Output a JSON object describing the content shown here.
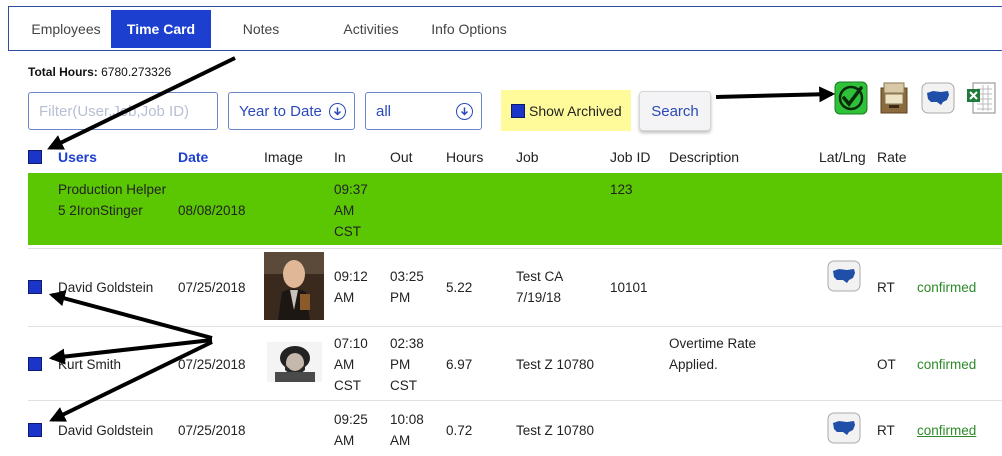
{
  "tabs": [
    {
      "label": "Employees"
    },
    {
      "label": "Time Card"
    },
    {
      "label": "Notes"
    },
    {
      "label": "Activities"
    },
    {
      "label": "Info Options"
    }
  ],
  "total_hours": {
    "label": "Total Hours:",
    "value": "6780.273326"
  },
  "filter": {
    "placeholder": "Filter(User,Job,Job ID)"
  },
  "period_select": {
    "value": "Year to Date"
  },
  "scope_select": {
    "value": "all"
  },
  "archived": {
    "label": "Show Archived"
  },
  "search_button": {
    "label": "Search"
  },
  "toolbar_icons": [
    "green-check-icon",
    "file-box-icon",
    "us-map-icon",
    "excel-sheet-icon"
  ],
  "columns": {
    "users": "Users",
    "date": "Date",
    "image": "Image",
    "in": "In",
    "out": "Out",
    "hours": "Hours",
    "job": "Job",
    "job_id": "Job ID",
    "description": "Description",
    "latlng": "Lat/Lng",
    "rate": "Rate"
  },
  "rows": [
    {
      "user": "Production Helper 5 2IronStinger",
      "date": "08/08/2018",
      "in": "09:37 AM CST",
      "out": "",
      "hours": "",
      "job": "",
      "job_id": "123",
      "description": "",
      "rate": "",
      "status": ""
    },
    {
      "user": "David Goldstein",
      "date": "07/25/2018",
      "in": "09:12 AM",
      "out": "03:25 PM",
      "hours": "5.22",
      "job": "Test CA 7/19/18",
      "job_id": "10101",
      "description": "",
      "rate": "RT",
      "status": "confirmed"
    },
    {
      "user": "Kurt Smith",
      "date": "07/25/2018",
      "in": "07:10 AM CST",
      "out": "02:38 PM CST",
      "hours": "6.97",
      "job": "Test Z 10780",
      "job_id": "",
      "description": "Overtime Rate Applied.",
      "rate": "OT",
      "status": "confirmed"
    },
    {
      "user": "David Goldstein",
      "date": "07/25/2018",
      "in": "09:25 AM",
      "out": "10:08 AM",
      "hours": "0.72",
      "job": "Test Z 10780",
      "job_id": "",
      "description": "",
      "rate": "RT",
      "status": "confirmed"
    }
  ],
  "colors": {
    "accent": "#1c3fd0",
    "highlight_row": "#5bc602",
    "archived_bg": "#fffb9a",
    "confirmed": "#2d8a2a"
  }
}
